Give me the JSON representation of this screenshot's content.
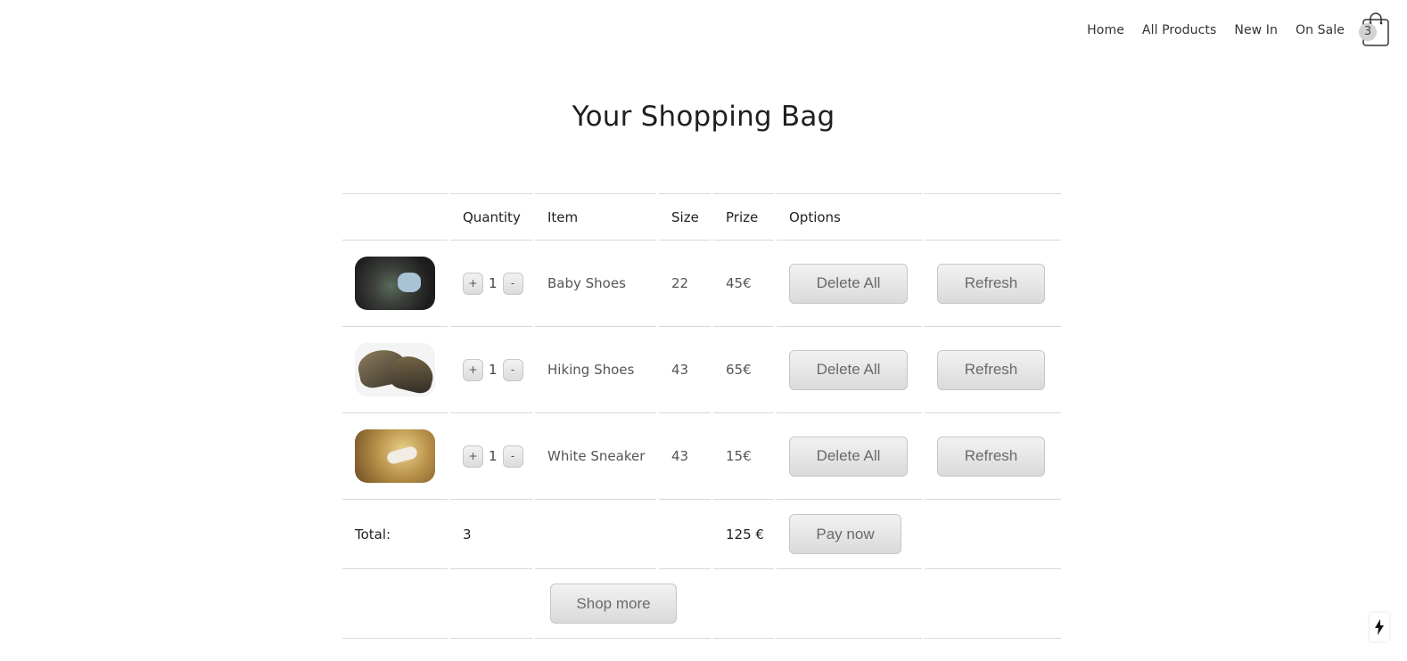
{
  "nav": {
    "links": [
      "Home",
      "All Products",
      "New In",
      "On Sale"
    ],
    "cart_count": "3"
  },
  "page": {
    "title": "Your Shopping Bag"
  },
  "table": {
    "headers": [
      "",
      "Quantity",
      "Item",
      "Size",
      "Prize",
      "Options",
      ""
    ],
    "items": [
      {
        "image": "baby-shoes-photo",
        "quantity": "1",
        "name": "Baby Shoes",
        "size": "22",
        "price": "45€",
        "delete_label": "Delete All",
        "refresh_label": "Refresh",
        "plus": "+",
        "minus": "-"
      },
      {
        "image": "hiking-shoes-photo",
        "quantity": "1",
        "name": "Hiking Shoes",
        "size": "43",
        "price": "65€",
        "delete_label": "Delete All",
        "refresh_label": "Refresh",
        "plus": "+",
        "minus": "-"
      },
      {
        "image": "white-sneaker-photo",
        "quantity": "1",
        "name": "White Sneaker",
        "size": "43",
        "price": "15€",
        "delete_label": "Delete All",
        "refresh_label": "Refresh",
        "plus": "+",
        "minus": "-"
      }
    ],
    "total": {
      "label": "Total:",
      "quantity": "3",
      "price": "125 €",
      "pay_label": "Pay now"
    },
    "shop_more_label": "Shop more"
  },
  "colors": {
    "border": "#d8d8d8",
    "button_bg": "#e6e6e6",
    "text": "#222222"
  },
  "icons": {
    "cart": "shopping-bag-icon",
    "widget": "lightning-bolt-icon"
  }
}
